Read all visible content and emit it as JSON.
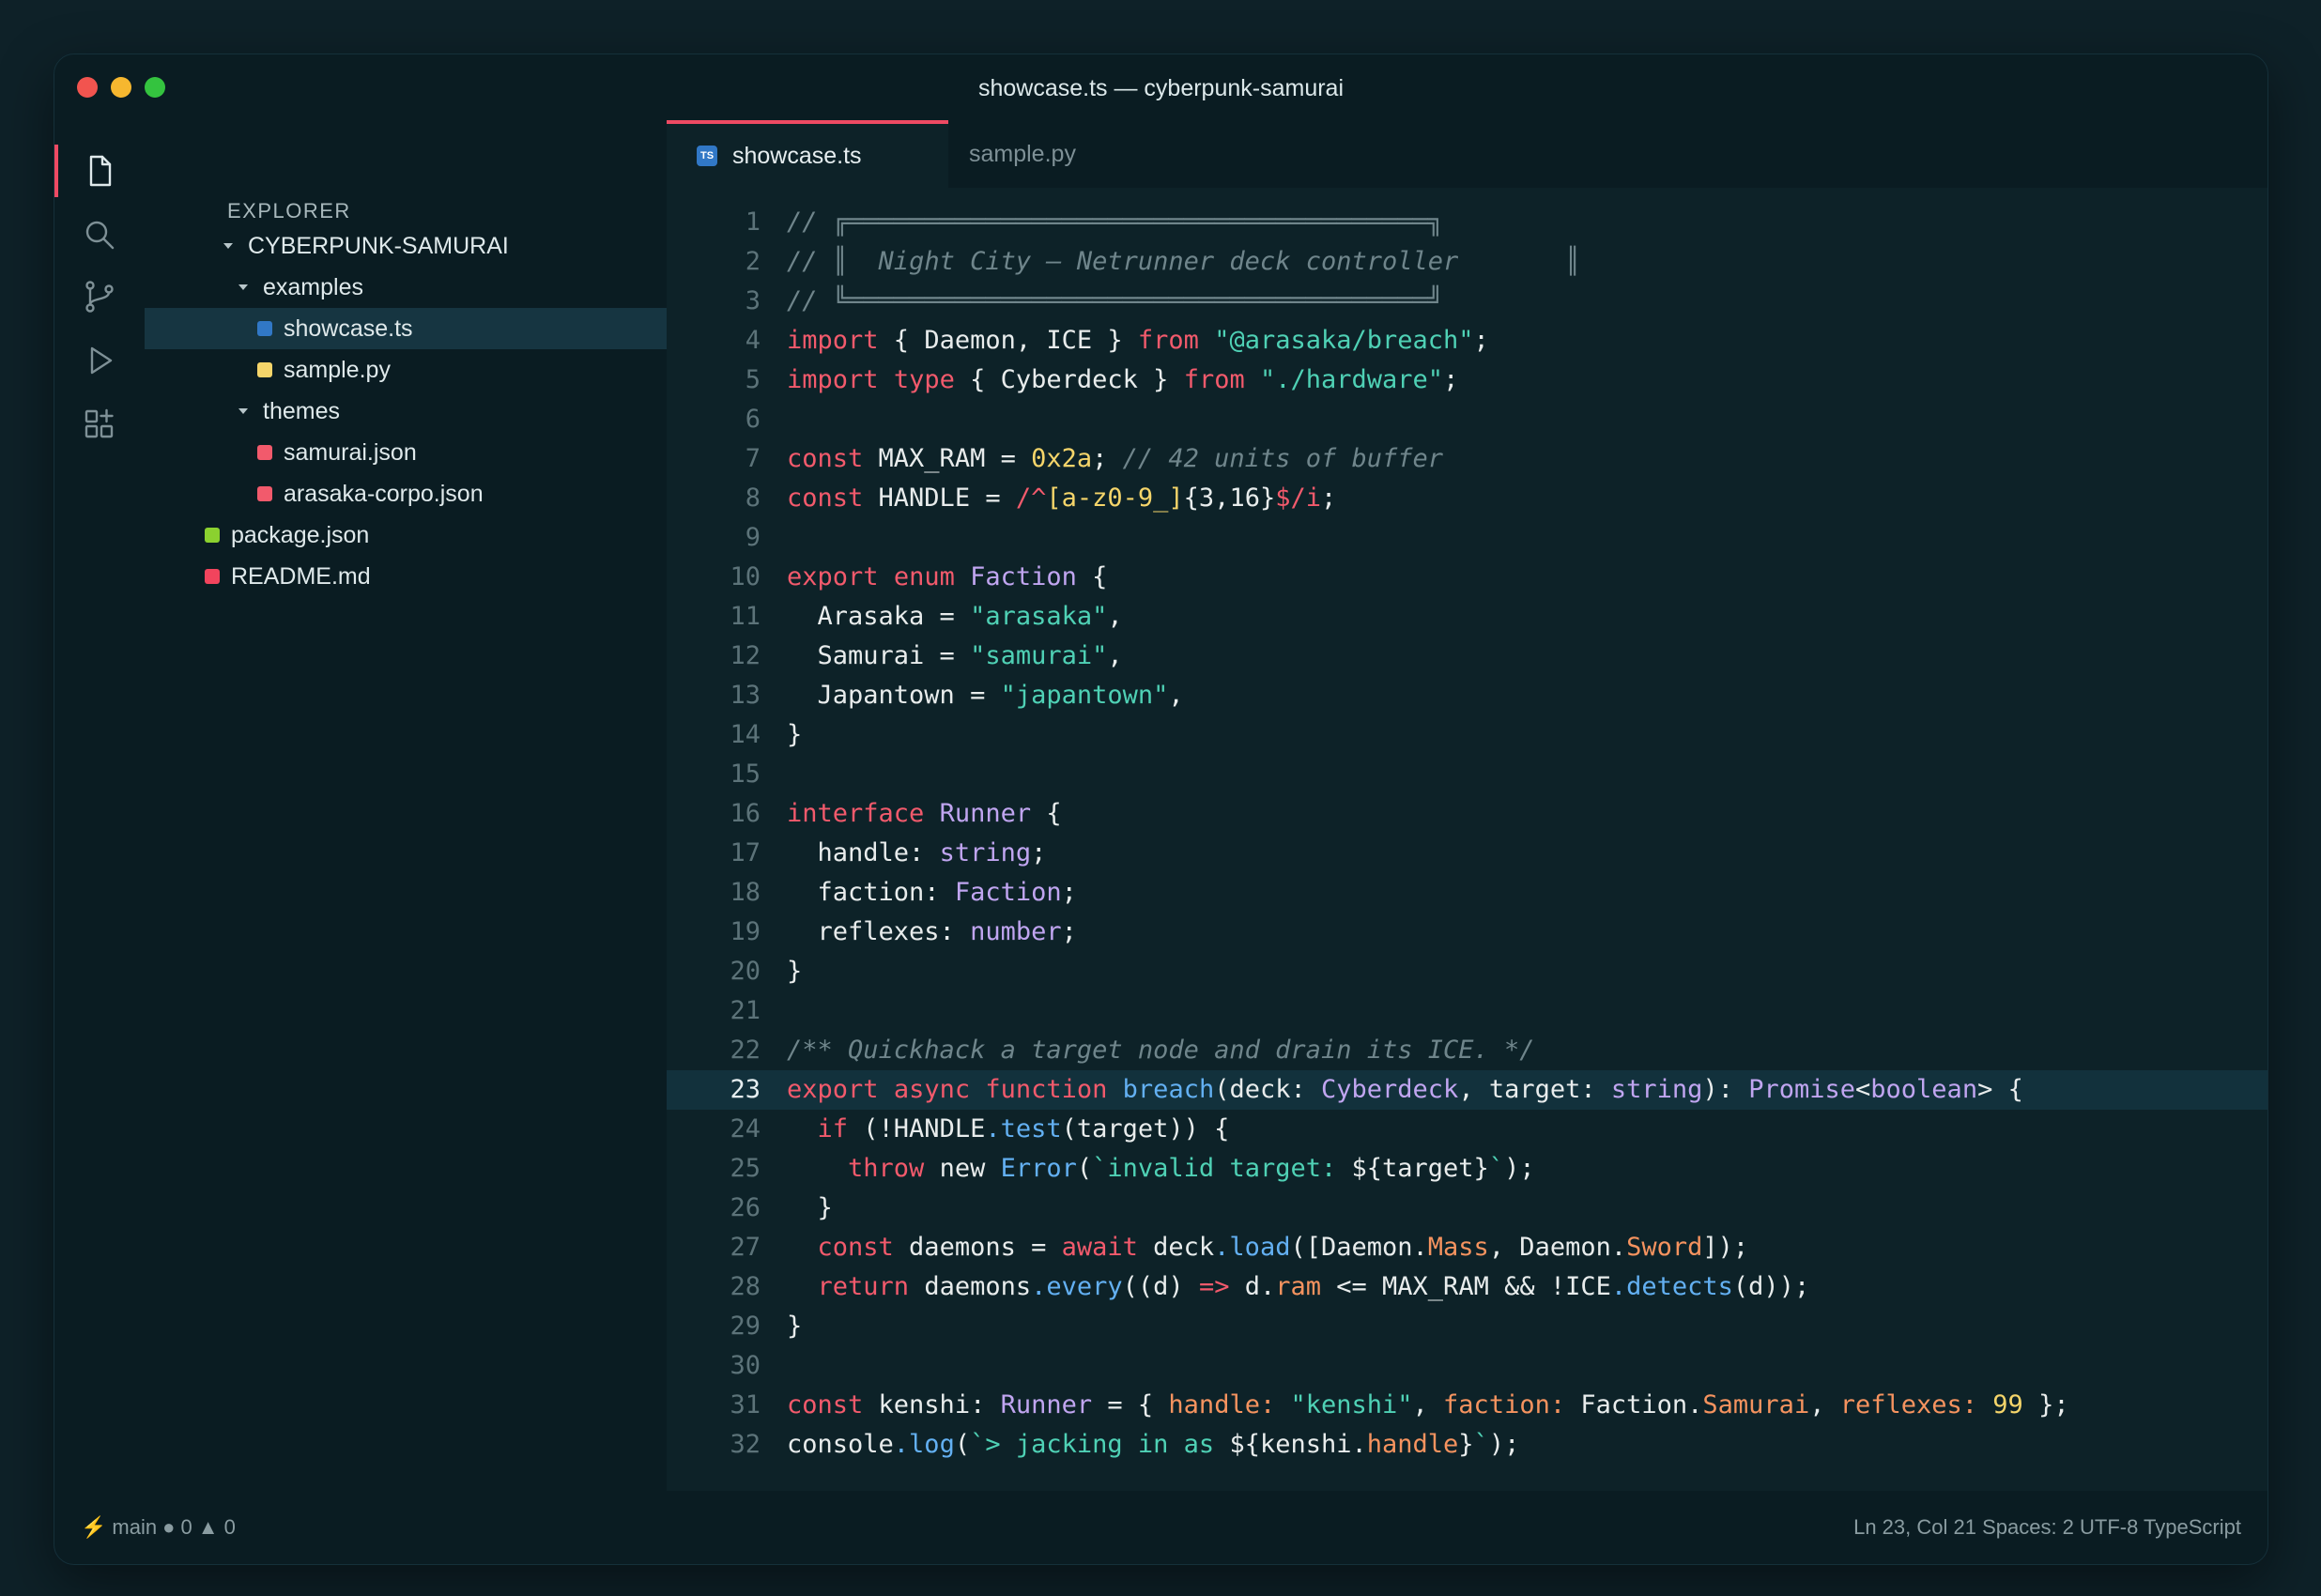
{
  "window": {
    "title": "showcase.ts — cyberpunk-samurai"
  },
  "sidebar": {
    "title": "EXPLORER",
    "root": "CYBERPUNK-SAMURAI",
    "items": [
      {
        "label": "examples",
        "type": "folder",
        "color": ""
      },
      {
        "label": "showcase.ts",
        "type": "file",
        "color": "#3178c6",
        "selected": true
      },
      {
        "label": "sample.py",
        "type": "file",
        "color": "#f5d56a"
      },
      {
        "label": "themes",
        "type": "folder",
        "color": ""
      },
      {
        "label": "samurai.json",
        "type": "file",
        "color": "#f25a6c"
      },
      {
        "label": "arasaka-corpo.json",
        "type": "file",
        "color": "#f25a6c"
      },
      {
        "label": "package.json",
        "type": "file",
        "color": "#8bd12f"
      },
      {
        "label": "README.md",
        "type": "file",
        "color": "#f2445d"
      }
    ]
  },
  "activitybar": {
    "icons": [
      "files-icon",
      "search-icon",
      "source-control-icon",
      "run-icon",
      "extensions-icon"
    ]
  },
  "tabs": [
    {
      "label": "showcase.ts",
      "badge": "TS",
      "active": true
    },
    {
      "label": "sample.py",
      "active": false
    }
  ],
  "editor": {
    "current_line": 23,
    "lines": [
      {
        "n": "1",
        "html": "<span class=\"comment\">// </span><span class=\"boxc\">╔══════════════════════════════════════╗</span>"
      },
      {
        "n": "2",
        "html": "<span class=\"comment\">// </span><span class=\"boxc\">║ </span><span class=\"comment\"> Night City — Netrunner deck controller</span><span class=\"boxc\">       ║</span>"
      },
      {
        "n": "3",
        "html": "<span class=\"comment\">// </span><span class=\"boxc\">╚══════════════════════════════════════╝</span>"
      },
      {
        "n": "4",
        "html": "<span class=\"k\">import</span> { Daemon, ICE } <span class=\"k\">from</span> <span class=\"s\">\"@arasaka/breach\"</span>;"
      },
      {
        "n": "5",
        "html": "<span class=\"k\">import</span> <span class=\"k\">type</span> { Cyberdeck } <span class=\"k\">from</span> <span class=\"s\">\"./hardware\"</span>;"
      },
      {
        "n": "6",
        "html": ""
      },
      {
        "n": "7",
        "html": "<span class=\"k\">const</span> MAX_RAM = <span class=\"nu\">0x2a</span>; <span class=\"comment\">// 42 units of buffer</span>"
      },
      {
        "n": "8",
        "html": "<span class=\"k\">const</span> HANDLE = <span class=\"k\">/^</span><span class=\"nu\">[a-z0-9_]</span>{3,16}<span class=\"k\">$/i</span>;"
      },
      {
        "n": "9",
        "html": ""
      },
      {
        "n": "10",
        "html": "<span class=\"k\">export</span> <span class=\"k\">enum</span> <span class=\"ty\">Faction</span> {"
      },
      {
        "n": "11",
        "html": "  Arasaka = <span class=\"s\">\"arasaka\"</span>,"
      },
      {
        "n": "12",
        "html": "  Samurai = <span class=\"s\">\"samurai\"</span>,"
      },
      {
        "n": "13",
        "html": "  Japantown = <span class=\"s\">\"japantown\"</span>,"
      },
      {
        "n": "14",
        "html": "}"
      },
      {
        "n": "15",
        "html": ""
      },
      {
        "n": "16",
        "html": "<span class=\"k\">interface</span> <span class=\"ty\">Runner</span> {"
      },
      {
        "n": "17",
        "html": "  handle: <span class=\"ty\">string</span>;"
      },
      {
        "n": "18",
        "html": "  faction: <span class=\"ty\">Faction</span>;"
      },
      {
        "n": "19",
        "html": "  reflexes: <span class=\"ty\">number</span>;"
      },
      {
        "n": "20",
        "html": "}"
      },
      {
        "n": "21",
        "html": ""
      },
      {
        "n": "22",
        "html": "<span class=\"comment\">/** Quickhack a target node and drain its ICE. */</span>"
      },
      {
        "n": "23",
        "html": "<span class=\"k\">export</span> <span class=\"k\">async</span> <span class=\"k\">function</span> <span class=\"fn\">breach</span>(deck: <span class=\"ty\">Cyberdeck</span>, target: <span class=\"ty\">string</span>): <span class=\"ty\">Promise</span>&lt;<span class=\"ty\">boolean</span>&gt; {"
      },
      {
        "n": "24",
        "html": "  <span class=\"k\">if</span> (!HANDLE<span class=\"fn\">.test</span>(target)) {"
      },
      {
        "n": "25",
        "html": "    <span class=\"k\">throw</span> new <span class=\"fn\">Error</span>(<span class=\"s\">`invalid target: </span>${target}<span class=\"s\">`</span>);"
      },
      {
        "n": "26",
        "html": "  }"
      },
      {
        "n": "27",
        "html": "  <span class=\"k\">const</span> daemons = <span class=\"k\">await</span> deck<span class=\"fn\">.load</span>([Daemon.<span class=\"pr\">Mass</span>, Daemon.<span class=\"pr\">Sword</span>]);"
      },
      {
        "n": "28",
        "html": "  <span class=\"k\">return</span> daemons<span class=\"fn\">.every</span>((d) <span class=\"k\">=&gt;</span> d.<span class=\"pr\">ram</span> &lt;= MAX_RAM &amp;&amp; !ICE<span class=\"fn\">.detects</span>(d));"
      },
      {
        "n": "29",
        "html": "}"
      },
      {
        "n": "30",
        "html": ""
      },
      {
        "n": "31",
        "html": "<span class=\"k\">const</span> kenshi: <span class=\"ty\">Runner</span> = { <span class=\"pr\">handle:</span> <span class=\"s\">\"kenshi\"</span>, <span class=\"pr\">faction:</span> Faction.<span class=\"pr\">Samurai</span>, <span class=\"pr\">reflexes:</span> <span class=\"nu\">99</span> };"
      },
      {
        "n": "32",
        "html": "console<span class=\"fn\">.log</span>(<span class=\"s\">`&gt; jacking in as </span>${kenshi.<span class=\"pr\">handle</span>}<span class=\"s\">`</span>);"
      }
    ]
  },
  "statusbar": {
    "branch": "main",
    "errors": "● 0",
    "warnings": "▲ 0",
    "right": "Ln 23, Col 21  Spaces: 2  UTF-8  TypeScript"
  }
}
